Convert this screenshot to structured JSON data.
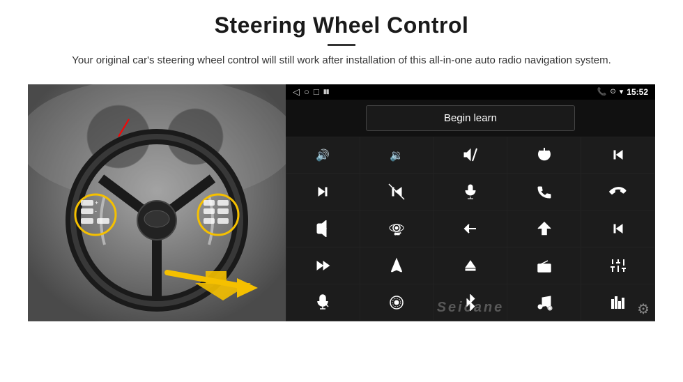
{
  "header": {
    "title": "Steering Wheel Control",
    "divider": true,
    "subtitle": "Your original car's steering wheel control will still work after installation of this all-in-one auto radio navigation system."
  },
  "statusbar": {
    "back_icon": "◁",
    "home_icon": "○",
    "square_icon": "□",
    "signal_icon": "▪▪",
    "phone_icon": "📞",
    "location_icon": "⊙",
    "wifi_icon": "▾",
    "time": "15:52"
  },
  "begin_learn": {
    "label": "Begin learn"
  },
  "controls": [
    {
      "id": "vol-up",
      "icon": "vol_up"
    },
    {
      "id": "vol-down",
      "icon": "vol_down"
    },
    {
      "id": "mute",
      "icon": "mute"
    },
    {
      "id": "power",
      "icon": "power"
    },
    {
      "id": "prev-track-end",
      "icon": "prev_track_end"
    },
    {
      "id": "skip-fwd",
      "icon": "skip_fwd"
    },
    {
      "id": "skip-prev",
      "icon": "skip_prev"
    },
    {
      "id": "mic",
      "icon": "mic"
    },
    {
      "id": "phone",
      "icon": "phone"
    },
    {
      "id": "hang-up",
      "icon": "hang_up"
    },
    {
      "id": "horn",
      "icon": "horn"
    },
    {
      "id": "360",
      "icon": "three_sixty"
    },
    {
      "id": "back",
      "icon": "back_arrow"
    },
    {
      "id": "home",
      "icon": "home"
    },
    {
      "id": "skip-back",
      "icon": "skip_back"
    },
    {
      "id": "ff",
      "icon": "fast_fwd"
    },
    {
      "id": "nav",
      "icon": "navigation"
    },
    {
      "id": "eject",
      "icon": "eject"
    },
    {
      "id": "radio",
      "icon": "radio"
    },
    {
      "id": "equalizer",
      "icon": "equalizer"
    },
    {
      "id": "mic2",
      "icon": "mic2"
    },
    {
      "id": "settings-round",
      "icon": "settings_round"
    },
    {
      "id": "bluetooth",
      "icon": "bluetooth"
    },
    {
      "id": "music",
      "icon": "music"
    },
    {
      "id": "levels",
      "icon": "levels"
    }
  ],
  "watermark": "Seicane",
  "gear_icon": "⚙"
}
